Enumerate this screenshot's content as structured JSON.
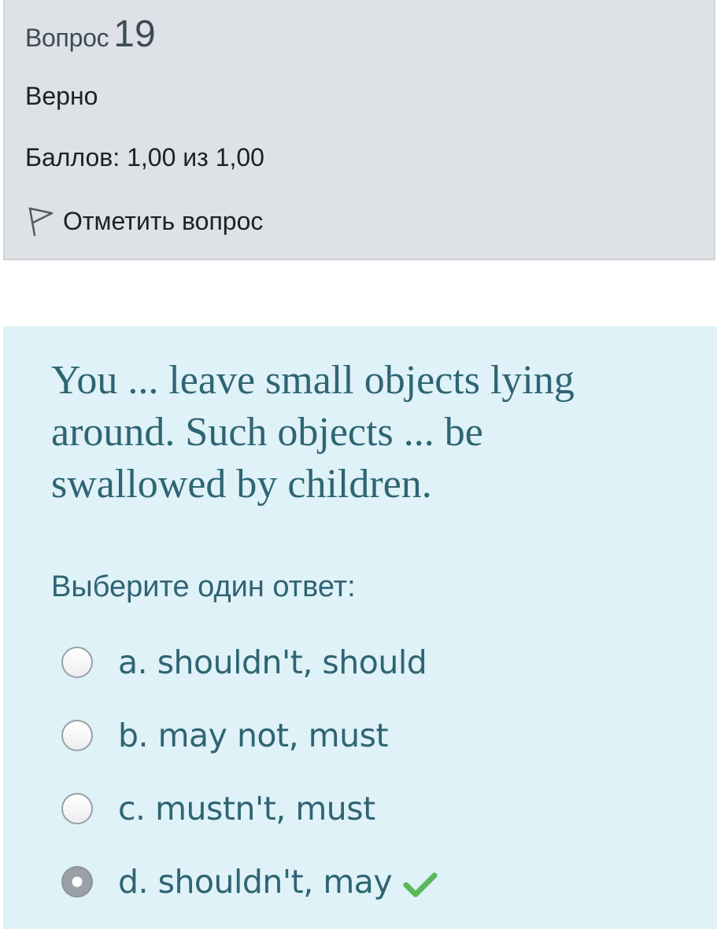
{
  "info": {
    "question_word": "Вопрос",
    "question_number": "19",
    "state": "Верно",
    "grade": "Баллов: 1,00 из 1,00",
    "flag_label": "Отметить вопрос",
    "flag_icon": "flag-outline-icon"
  },
  "question": {
    "text": "You ... leave small objects lying around. Such objects ... be swallowed by children.",
    "prompt": "Выберите один ответ:",
    "answers": [
      {
        "label": "a. shouldn't, should",
        "selected": false
      },
      {
        "label": "b. may not, must",
        "selected": false
      },
      {
        "label": "c. mustn't, must",
        "selected": false
      },
      {
        "label": "d. shouldn't, may",
        "selected": true,
        "feedback_icon": "check-icon"
      }
    ]
  },
  "colors": {
    "info_bg": "#dee2e6",
    "formulation_bg": "#def2f8",
    "question_text": "#2f6473",
    "correct_green": "#5cb85c"
  }
}
